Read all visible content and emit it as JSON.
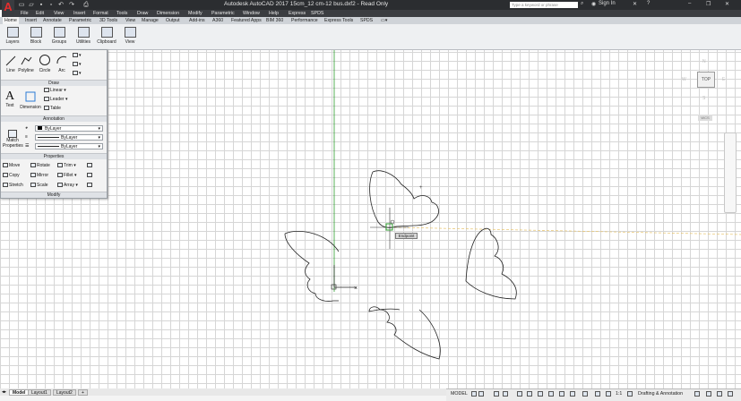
{
  "app": {
    "title": "Autodesk AutoCAD 2017    15cm_12 cm-12 bus.dxf2 - Read Only",
    "logo": "A",
    "search_placeholder": "Type a keyword or phrase",
    "sign_in": "Sign In"
  },
  "menu": [
    "File",
    "Edit",
    "View",
    "Insert",
    "Format",
    "Tools",
    "Draw",
    "Dimension",
    "Modify",
    "Parametric",
    "Window",
    "Help",
    "Express",
    "SPDS"
  ],
  "ribbon_tabs": [
    "Home",
    "Insert",
    "Annotate",
    "Parametric",
    "3D Tools",
    "View",
    "Manage",
    "Output",
    "Add-ins",
    "A360",
    "Featured Apps",
    "BIM 360",
    "Performance",
    "Express Tools",
    "SPDS"
  ],
  "ribbon_buttons": [
    "Layers",
    "Block",
    "Groups",
    "Utilities",
    "Clipboard",
    "View"
  ],
  "panel": {
    "draw": {
      "header": "Draw",
      "line": "Line",
      "polyline": "Polyline",
      "circle": "Circle",
      "arc": "Arc"
    },
    "annotation": {
      "header": "Annotation",
      "text": "Text",
      "dimension": "Dimension",
      "linear": "Linear",
      "leader": "Leader",
      "table": "Table"
    },
    "properties": {
      "header": "Properties",
      "match": "Match\nProperties",
      "bylayer1": "ByLayer",
      "bylayer2": "ByLayer",
      "bylayer3": "ByLayer"
    },
    "modify": {
      "header": "Modify",
      "move": "Move",
      "rotate": "Rotate",
      "trim": "Trim",
      "copy": "Copy",
      "mirror": "Mirror",
      "fillet": "Fillet",
      "stretch": "Stretch",
      "scale": "Scale",
      "array": "Array"
    }
  },
  "viewcube": {
    "top": "TOP",
    "n": "N",
    "w": "W",
    "e": "E",
    "s": "S",
    "wcs": "WCS"
  },
  "canvas": {
    "tooltip": "Endpoint"
  },
  "layout_tabs": [
    "Model",
    "Layout1",
    "Layout2",
    "+"
  ],
  "status": {
    "model": "MODEL",
    "scale": "1:1",
    "workspace": "Drafting & Annotation"
  },
  "colors": {
    "accent": "#2b7bd6",
    "grid": "#d6d6d6",
    "title_bar": "#2b2d30",
    "snap": "#2e9e2e"
  }
}
